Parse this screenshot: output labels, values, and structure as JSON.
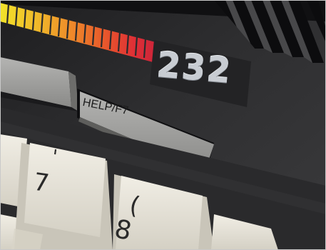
{
  "photo": {
    "subject_text": {
      "model_badge": "232",
      "help_key": "HELP/F7",
      "key_seven_upper": "'",
      "key_seven_lower": "7",
      "key_eight_upper": "(",
      "key_eight_lower": "8"
    },
    "colors": {
      "case": "#2b2b2d",
      "case_dark": "#18181a",
      "function_key": "#9a9a98",
      "keycap": "#e6e2d6",
      "badge_text": "#c8ccd2",
      "rainbow": [
        "#f2e32a",
        "#f0b62a",
        "#ee8a2a",
        "#e85a2b",
        "#df2f36",
        "#c9243a"
      ]
    }
  }
}
